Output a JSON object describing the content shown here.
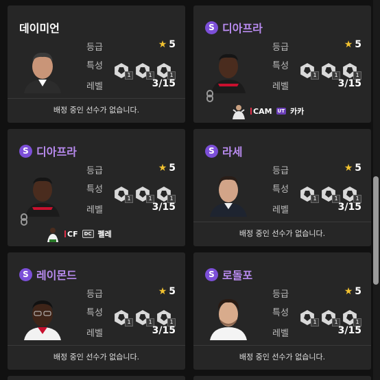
{
  "labels": {
    "grade": "등급",
    "trait": "특성",
    "level": "레벨"
  },
  "badge": "S",
  "cards": [
    {
      "name": "데이미언",
      "special": false,
      "grade": "5",
      "level": "3/15",
      "trait_levels": [
        "1",
        "1",
        "1"
      ],
      "footer": "배정 중인 선수가 없습니다."
    },
    {
      "name": "디아프라",
      "special": true,
      "grade": "5",
      "level": "3/15",
      "trait_levels": [
        "1",
        "1",
        "1"
      ],
      "assigned": {
        "position": "CAM",
        "season": "UT",
        "player": "카카"
      }
    },
    {
      "name": "디아프라",
      "special": true,
      "grade": "5",
      "level": "3/15",
      "trait_levels": [
        "1",
        "1",
        "1"
      ],
      "assigned": {
        "position": "CF",
        "season": "DC",
        "player": "펠레"
      }
    },
    {
      "name": "라세",
      "special": true,
      "grade": "5",
      "level": "3/15",
      "trait_levels": [
        "1",
        "1",
        "1"
      ],
      "footer": "배정 중인 선수가 없습니다."
    },
    {
      "name": "레이몬드",
      "special": true,
      "grade": "5",
      "level": "3/15",
      "trait_levels": [
        "1",
        "1",
        "1"
      ],
      "footer": "배정 중인 선수가 없습니다."
    },
    {
      "name": "로돌포",
      "special": true,
      "grade": "5",
      "level": "3/15",
      "trait_levels": [
        "1",
        "1",
        "1"
      ],
      "footer": "배정 중인 선수가 없습니다."
    }
  ],
  "colors": {
    "background": "#111111",
    "card": "#262626",
    "special_name": "#b98bf0",
    "badge": "#7c4fd8",
    "star": "#f2c230",
    "position_bar": "#e0304a"
  }
}
